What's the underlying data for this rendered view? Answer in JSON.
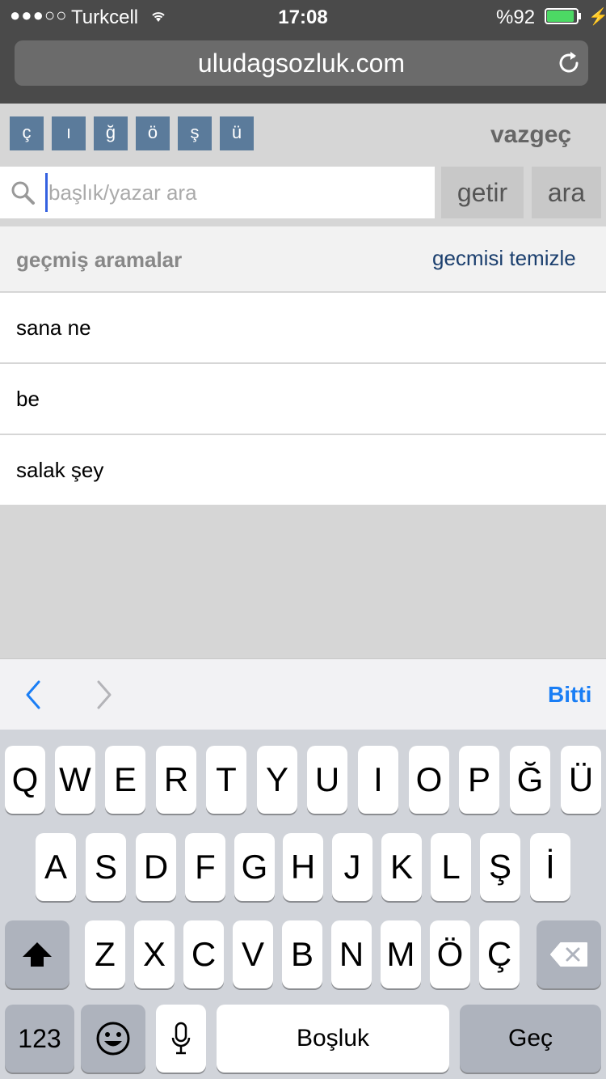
{
  "status_bar": {
    "signal": "●●●○○",
    "carrier": "Turkcell",
    "time": "17:08",
    "battery": "%92",
    "battery_level": 0.92
  },
  "browser": {
    "url": "uludagsozluk.com"
  },
  "char_buttons": [
    "ç",
    "ı",
    "ğ",
    "ö",
    "ş",
    "ü"
  ],
  "cancel_label": "vazgeç",
  "search": {
    "placeholder": "başlık/yazar ara",
    "value": "",
    "getir_label": "getir",
    "ara_label": "ara"
  },
  "history": {
    "title": "geçmiş aramalar",
    "clear_label": "gecmisi temizle",
    "items": [
      "sana ne",
      "be",
      "salak şey"
    ]
  },
  "accessory": {
    "done_label": "Bitti"
  },
  "keyboard": {
    "row1": [
      "Q",
      "W",
      "E",
      "R",
      "T",
      "Y",
      "U",
      "I",
      "O",
      "P",
      "Ğ",
      "Ü"
    ],
    "row2": [
      "A",
      "S",
      "D",
      "F",
      "G",
      "H",
      "J",
      "K",
      "L",
      "Ş",
      "İ"
    ],
    "row3": [
      "Z",
      "X",
      "C",
      "V",
      "B",
      "N",
      "M",
      "Ö",
      "Ç"
    ],
    "numbers_label": "123",
    "space_label": "Boşluk",
    "go_label": "Geç"
  },
  "colors": {
    "accent": "#1a7ef5",
    "char_button": "#5b7b9b",
    "link": "#1b3f6e"
  }
}
